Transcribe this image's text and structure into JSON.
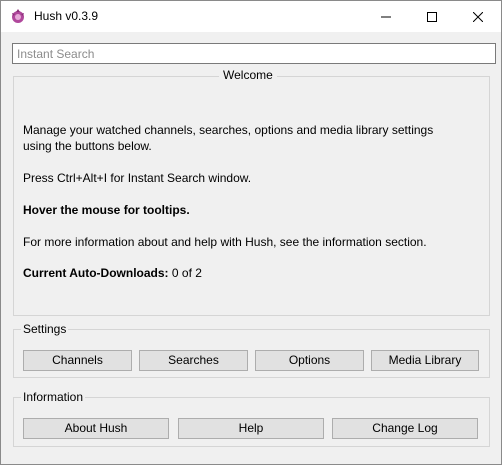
{
  "window": {
    "title": "Hush v0.3.9",
    "controls": {
      "minimize_icon": "minimize-icon",
      "maximize_icon": "maximize-icon",
      "close_icon": "close-icon"
    }
  },
  "search": {
    "placeholder": "Instant Search",
    "value": ""
  },
  "welcome": {
    "title": "Welcome",
    "line1": "Manage your watched channels, searches, options and media library settings",
    "line2": "using the buttons below.",
    "shortcut": "Press Ctrl+Alt+I for Instant Search window.",
    "tooltips": "Hover the mouse for tooltips.",
    "more_info": "For more information about and help with Hush, see the information section.",
    "auto_label": "Current Auto-Downloads:",
    "auto_value": "0 of 2"
  },
  "settings": {
    "label": "Settings",
    "channels": "Channels",
    "searches": "Searches",
    "options": "Options",
    "media_library": "Media Library"
  },
  "information": {
    "label": "Information",
    "about": "About Hush",
    "help": "Help",
    "change_log": "Change Log"
  },
  "colors": {
    "window_bg": "#f0f0f0",
    "titlebar_bg": "#ffffff",
    "button_bg": "#e1e1e1",
    "button_border": "#adadad",
    "groupbox_border": "#d5d5d5"
  }
}
